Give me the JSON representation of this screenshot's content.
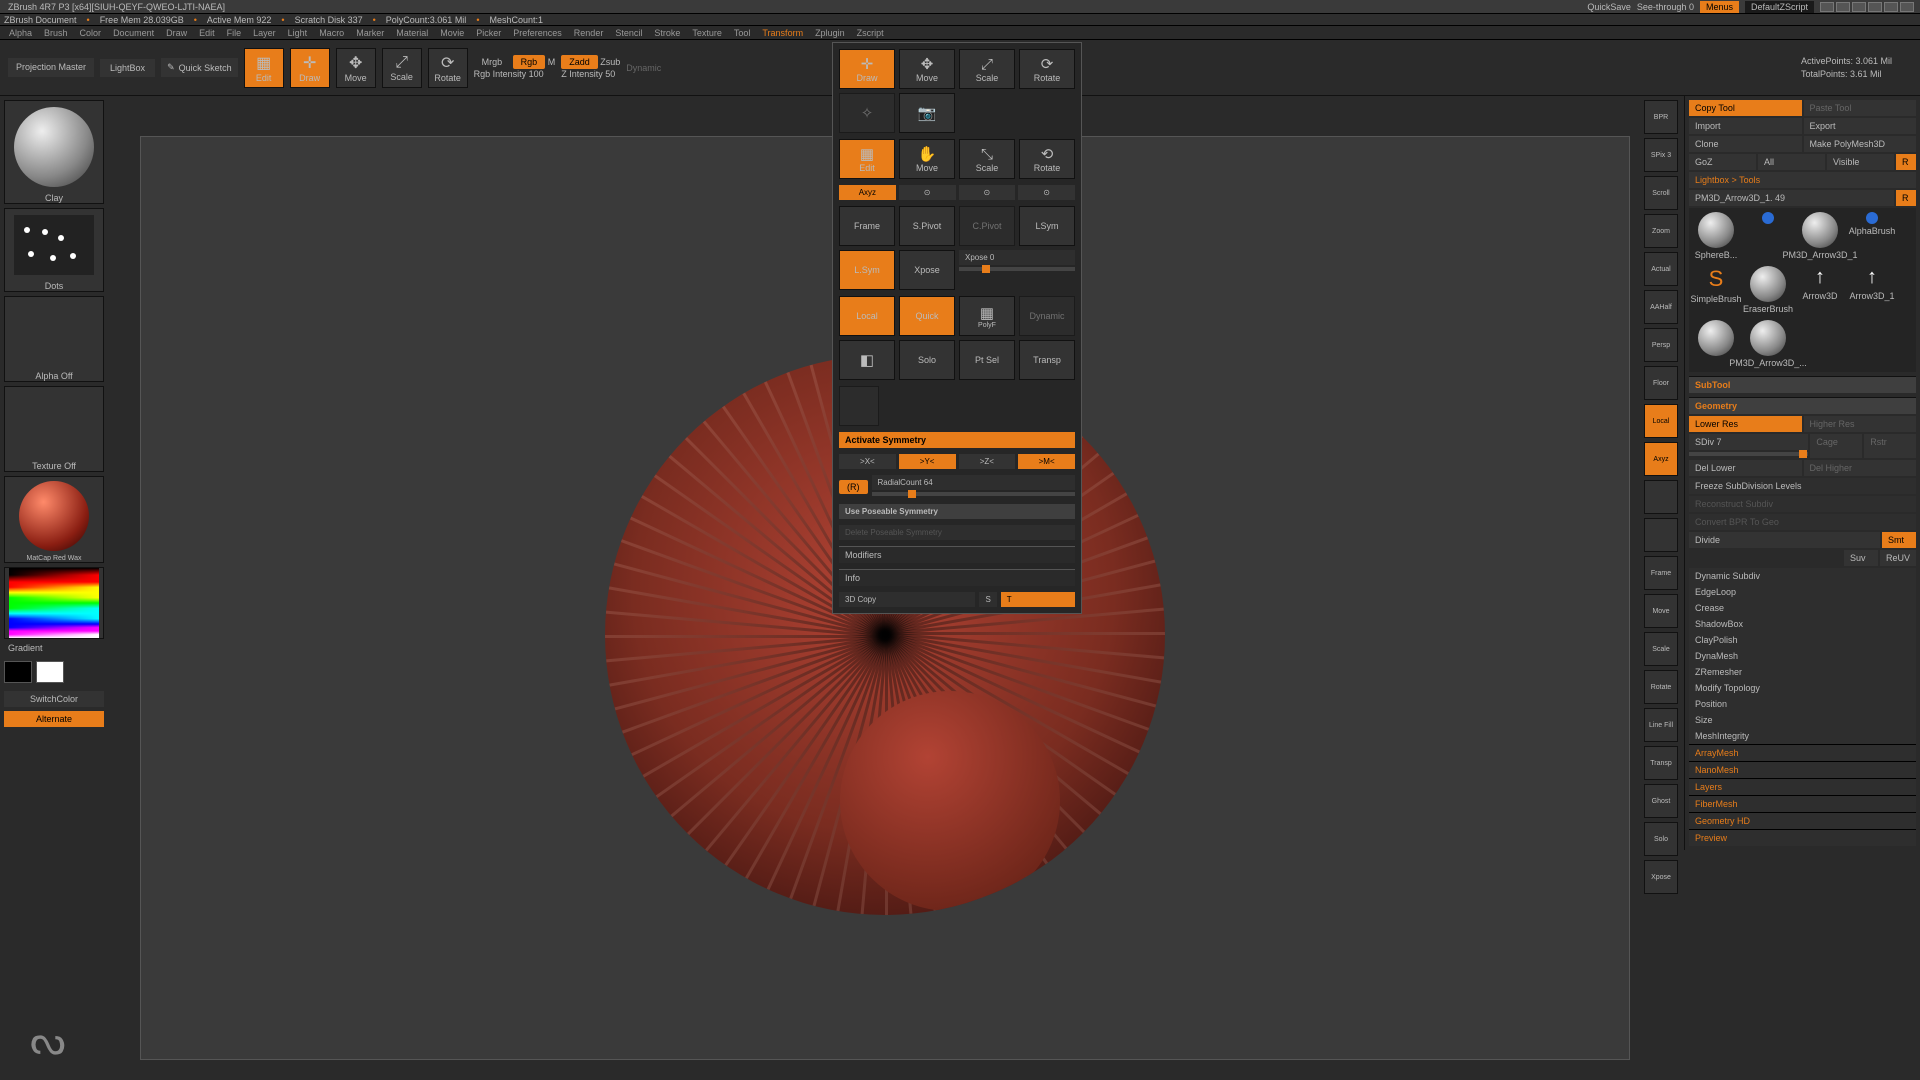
{
  "titlebar": {
    "title": "ZBrush 4R7 P3 [x64][SIUH-QEYF-QWEO-LJTI-NAEA]",
    "quick_save": "QuickSave",
    "see_through": "See-through   0",
    "menus": "Menus",
    "scheme": "DefaultZScript"
  },
  "status": {
    "doc": "ZBrush Document",
    "free_mem": "Free Mem 28.039GB",
    "active_mem": "Active Mem 922",
    "scratch": "Scratch Disk 337",
    "polycount": "PolyCount:3.061 Mil",
    "mesh": "MeshCount:1"
  },
  "menu": [
    "Alpha",
    "Brush",
    "Color",
    "Document",
    "Draw",
    "Edit",
    "File",
    "Layer",
    "Light",
    "Macro",
    "Marker",
    "Material",
    "Movie",
    "Picker",
    "Preferences",
    "Render",
    "Stencil",
    "Stroke",
    "Texture",
    "Tool",
    "Transform",
    "Zplugin",
    "Zscript"
  ],
  "menu_hi_index": 20,
  "toolbar": {
    "proj": "Projection\nMaster",
    "lightbox": "LightBox",
    "quick": "Quick\nSketch",
    "edit": "Edit",
    "draw": "Draw",
    "move": "Move",
    "scale": "Scale",
    "rotate": "Rotate",
    "mrgb": "Mrgb",
    "rgb": "Rgb",
    "m": "M",
    "rgb_int": "Rgb Intensity 100",
    "zadd": "Zadd",
    "zsub": "Zsub",
    "zint": "Z Intensity 50",
    "dynamic": "Dynamic",
    "active_pts": "ActivePoints: 3.061  Mil",
    "total_pts": "TotalPoints: 3.61  Mil"
  },
  "left": {
    "clay": "Clay",
    "dots": "Dots",
    "alpha_off": "Alpha Off",
    "texture_off": "Texture Off",
    "matcap": "MatCap Red Wax",
    "gradient": "Gradient",
    "switch": "SwitchColor",
    "alternate": "Alternate"
  },
  "rr": [
    "BPR",
    "SPix 3",
    "Scroll",
    "Zoom",
    "Actual",
    "AAHalf",
    "Persp",
    "Floor",
    "Local",
    "Axyz",
    "",
    "",
    "Frame",
    "Move",
    "Scale",
    "Rotate",
    "Line Fill",
    "Transp",
    "Ghost",
    "Solo",
    "Xpose"
  ],
  "rr_on": [
    8,
    9
  ],
  "popup": {
    "draw": "Draw",
    "move": "Move",
    "scale": "Scale",
    "rotate": "Rotate",
    "edit": "Edit",
    "pmove": "Move",
    "pscale": "Scale",
    "protate": "Rotate",
    "axyz": "Axyz",
    "frame": "Frame",
    "spivot": "S.Pivot",
    "c_pivot": "C.Pivot",
    "lsym": "LSym",
    "lsym2": "L.Sym",
    "xpose_btn": "Xpose",
    "xpose": "Xpose 0",
    "local": "Local",
    "quick": "Quick",
    "polyf": "PolyF",
    "line": "Line Fil",
    "dynamic": "Dynamic",
    "transp": "Transp",
    "solo": "Solo",
    "ptsel": "Pt Sel",
    "pttransp": "Transp",
    "activate": "Activate Symmetry",
    "x": ">X<",
    "y": ">Y<",
    "z": ">Z<",
    "m": ">M<",
    "r": "(R)",
    "radial": "RadialCount 64",
    "usepose": "Use Poseable Symmetry",
    "delpose": "Delete Poseable Symmetry",
    "modifiers": "Modifiers",
    "info": "Info",
    "copy3d": "3D Copy",
    "s": "S",
    "t": "T"
  },
  "tool": {
    "copy": "Copy Tool",
    "paste": "Paste Tool",
    "import": "Import",
    "export": "Export",
    "clone": "Clone",
    "make": "Make PolyMesh3D",
    "goz": "GoZ",
    "all": "All",
    "visible": "Visible",
    "r": "R",
    "hdr": "Lightbox > Tools",
    "active": "PM3D_Arrow3D_1. 49",
    "r2": "R",
    "slots": [
      "SphereB...",
      "",
      "PM3D_Arrow3D_1",
      "AlphaBrush",
      "SimpleBrush",
      "EraserBrush",
      "Arrow3D",
      "Arrow3D_1",
      "",
      "PM3D_Arrow3D_..."
    ],
    "subtool": "SubTool",
    "geom": "Geometry",
    "lower": "Lower Res",
    "higher": "Higher Res",
    "sdiv": "SDiv 7",
    "cage": "Cage",
    "rstr": "Rstr",
    "dellow": "Del Lower",
    "delhigh": "Del Higher",
    "freeze": "Freeze SubDivision Levels",
    "reconstruct": "Reconstruct Subdiv",
    "convert": "Convert BPR To Geo",
    "divide": "Divide",
    "smt": "Smt",
    "suv": "Suv",
    "reuv": "ReUV",
    "items": [
      "Dynamic Subdiv",
      "EdgeLoop",
      "Crease",
      "ShadowBox",
      "ClayPolish",
      "DynaMesh",
      "ZRemesher",
      "Modify Topology",
      "Position",
      "Size",
      "MeshIntegrity",
      "ArrayMesh",
      "NanoMesh",
      "Layers",
      "FiberMesh",
      "Geometry HD",
      "Preview"
    ],
    "items_strong": [
      11,
      12,
      13,
      14,
      15,
      16
    ]
  }
}
